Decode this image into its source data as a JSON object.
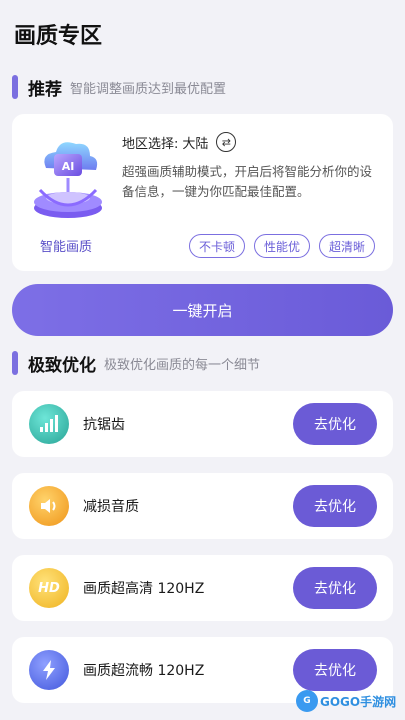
{
  "page": {
    "title": "画质专区"
  },
  "recommend": {
    "title": "推荐",
    "subtitle": "智能调整画质达到最优配置",
    "region_label": "地区选择:",
    "region_value": "大陆",
    "description": "超强画质辅助模式，开启后将智能分析你的设备信息，一键为你匹配最佳配置。",
    "caption": "智能画质",
    "tags": [
      "不卡顿",
      "性能优",
      "超清晰"
    ],
    "illustration_icon": "ai-cloud-icon"
  },
  "one_click": {
    "label": "一键开启"
  },
  "optimize": {
    "title": "极致优化",
    "subtitle": "极致优化画质的每一个细节",
    "items": [
      {
        "label": "抗锯齿",
        "button": "去优化",
        "icon": "signal-bars-icon",
        "color_from": "#4fd1c5",
        "color_to": "#2ba89c"
      },
      {
        "label": "减损音质",
        "button": "去优化",
        "icon": "speaker-icon",
        "color_from": "#f9c04a",
        "color_to": "#f19a20"
      },
      {
        "label": "画质超高清 120HZ",
        "button": "去优化",
        "icon": "hd-icon",
        "color_from": "#f7d35a",
        "color_to": "#f0b72a"
      },
      {
        "label": "画质超流畅 120HZ",
        "button": "去优化",
        "icon": "lightning-icon",
        "color_from": "#7a8cf5",
        "color_to": "#4f63e3"
      }
    ]
  },
  "watermark": {
    "text": "GOGO手游网"
  },
  "colors": {
    "accent": "#7b6fe0",
    "button": "#6b5bd6",
    "background": "#f2f2f7"
  }
}
